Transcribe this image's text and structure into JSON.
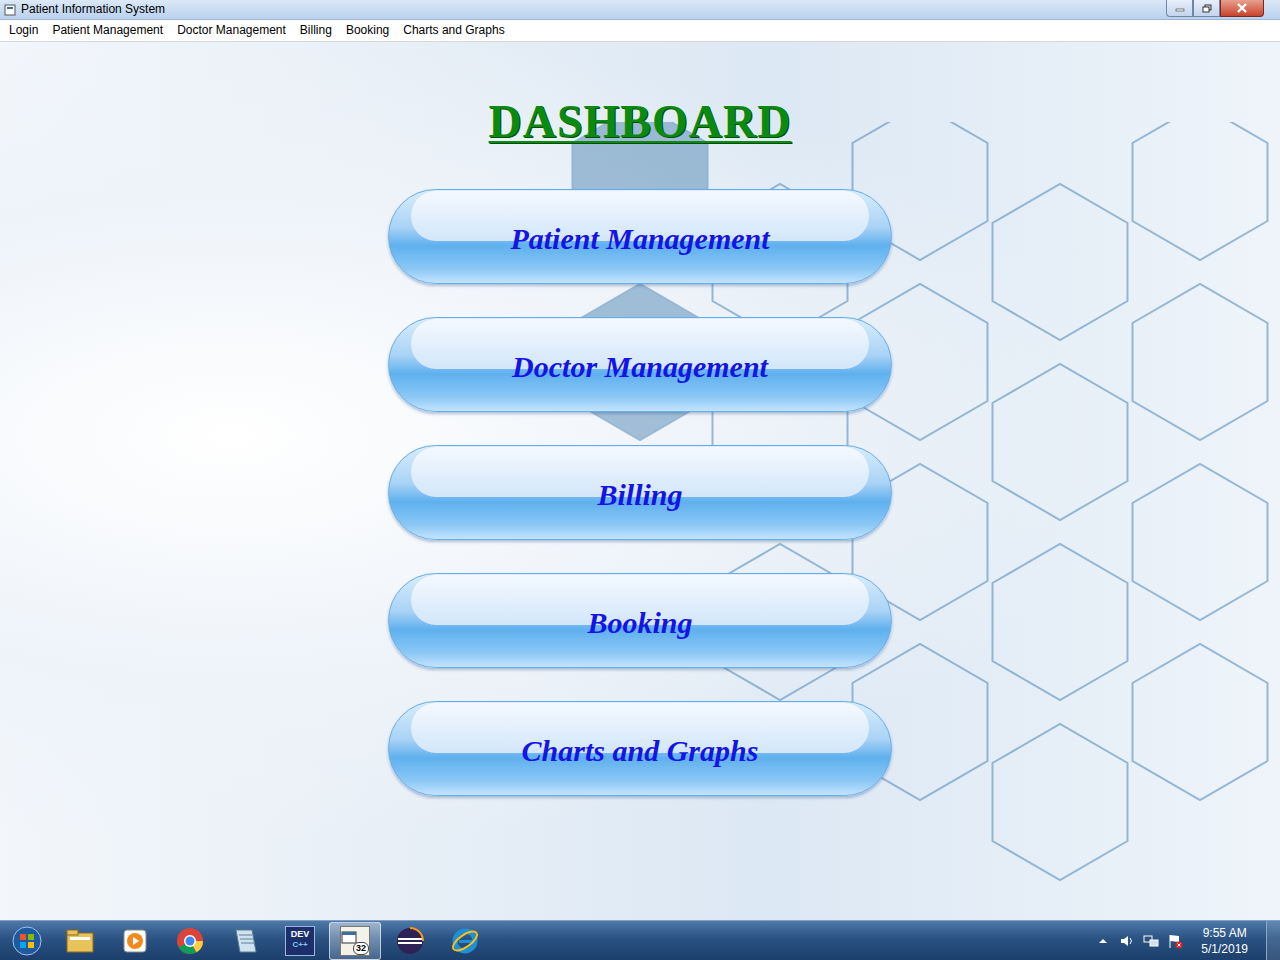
{
  "window": {
    "title": "Patient Information System"
  },
  "menu": [
    "Login",
    "Patient Management",
    "Doctor Management",
    "Billing",
    "Booking",
    "Charts and Graphs"
  ],
  "dashboard": {
    "title": "DASHBOARD",
    "buttons": [
      "Patient Management",
      "Doctor Management",
      "Billing",
      "Booking",
      "Charts and Graphs"
    ]
  },
  "taskbar": {
    "apps": [
      {
        "kind": "explorer",
        "selected": false
      },
      {
        "kind": "media",
        "selected": false
      },
      {
        "kind": "chrome",
        "selected": false
      },
      {
        "kind": "notes",
        "selected": false
      },
      {
        "kind": "devcpp",
        "selected": false,
        "text": "DEV",
        "subtext": "C++"
      },
      {
        "kind": "app32",
        "selected": true,
        "text": "32"
      },
      {
        "kind": "eclipse",
        "selected": false
      },
      {
        "kind": "ie",
        "selected": false
      }
    ],
    "time": "9:55 AM",
    "date": "5/1/2019"
  }
}
